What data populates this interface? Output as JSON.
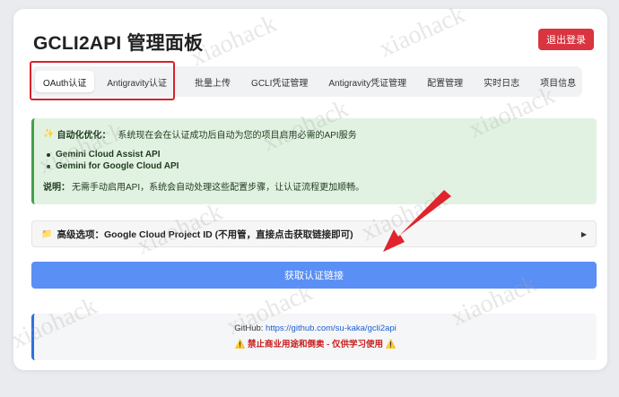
{
  "header": {
    "title": "GCLI2API 管理面板",
    "logout_label": "退出登录"
  },
  "tabs": [
    {
      "label": "OAuth认证"
    },
    {
      "label": "Antigravity认证"
    },
    {
      "label": "批量上传"
    },
    {
      "label": "GCLI凭证管理"
    },
    {
      "label": "Antigravity凭证管理"
    },
    {
      "label": "配置管理"
    },
    {
      "label": "实时日志"
    },
    {
      "label": "项目信息"
    }
  ],
  "info": {
    "icon": "sparkle-icon",
    "heading": "自动化优化：",
    "text": "系统现在会在认证成功后自动为您的项目启用必需的API服务",
    "services": [
      "Gemini Cloud Assist API",
      "Gemini for Google Cloud API"
    ],
    "note_label": "说明：",
    "note_text": "无需手动启用API，系统会自动处理这些配置步骤，让认证流程更加顺畅。"
  },
  "advanced": {
    "icon": "folder-icon",
    "label": "高级选项：Google Cloud Project ID (不用管，直接点击获取链接即可)",
    "arrow": "▶"
  },
  "get_link_label": "获取认证链接",
  "footer": {
    "github_label": "GitHub:",
    "github_url": "https://github.com/su-kaka/gcli2api",
    "warning_icon": "⚠️",
    "warning_text": "禁止商业用途和倒卖 - 仅供学习使用"
  },
  "watermark": "xiaohack",
  "colors": {
    "logout": "#d9343f",
    "primary": "#5a8ff5",
    "info_bg": "#e2f2e2",
    "highlight": "#d6222c",
    "arrow": "#e0242b"
  }
}
